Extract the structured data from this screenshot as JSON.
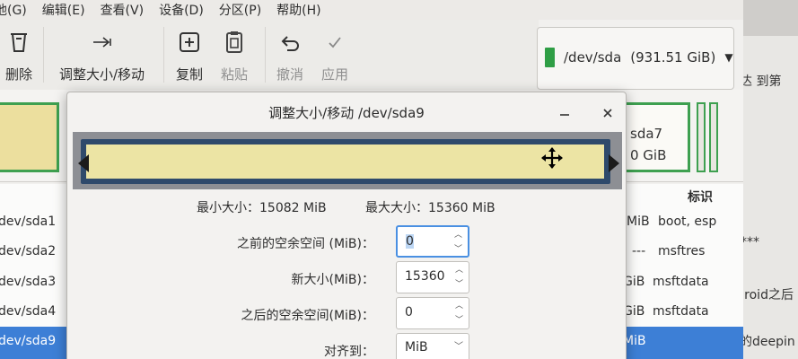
{
  "menubar": {
    "items": [
      "他(G)",
      "编辑(E)",
      "查看(V)",
      "设备(D)",
      "分区(P)",
      "帮助(H)"
    ]
  },
  "toolbar": {
    "delete": "删除",
    "resize_move": "调整大小/移动",
    "copy": "复制",
    "paste": "粘贴",
    "undo": "撤消",
    "apply": "应用"
  },
  "device_selector": {
    "label": "/dev/sda",
    "size": "(931.51 GiB)"
  },
  "partition_map": {
    "sda7_label": "sda7",
    "sda7_size": "0 GiB"
  },
  "partition_list": {
    "header_flags": "标识",
    "rows": [
      {
        "name": "dev/sda1",
        "size": "MiB",
        "flags": "boot, esp"
      },
      {
        "name": "dev/sda2",
        "size": "---",
        "flags": "msftres"
      },
      {
        "name": "dev/sda3",
        "size": "GiB",
        "flags": "msftdata"
      },
      {
        "name": "dev/sda4",
        "size": "GiB",
        "flags": "msftdata"
      },
      {
        "name": "dev/sda9",
        "size": "MiB",
        "flags": ""
      }
    ]
  },
  "right_panel": {
    "top_text": "达 到第",
    "stars": "****",
    "line1": "了xdroid之后",
    "line2": "最新的deepin"
  },
  "dialog": {
    "title": "调整大小/移动 /dev/sda9",
    "min_label": "最小大小：",
    "min_value": "15082 MiB",
    "max_label": "最大大小：",
    "max_value": "15360 MiB",
    "free_before_label": "之前的空余空间 (MiB)：",
    "free_before_value": "0",
    "new_size_label": "新大小(MiB)：",
    "new_size_value": "15360",
    "free_after_label": "之后的空余空间(MiB)：",
    "free_after_value": "0",
    "align_label": "对齐到：",
    "align_value": "MiB"
  },
  "colors": {
    "selection": "#3d7fd6",
    "partition_border": "#3ea050",
    "partition_fill": "#ecdf9e",
    "resize_frame": "#2f4a6b"
  }
}
